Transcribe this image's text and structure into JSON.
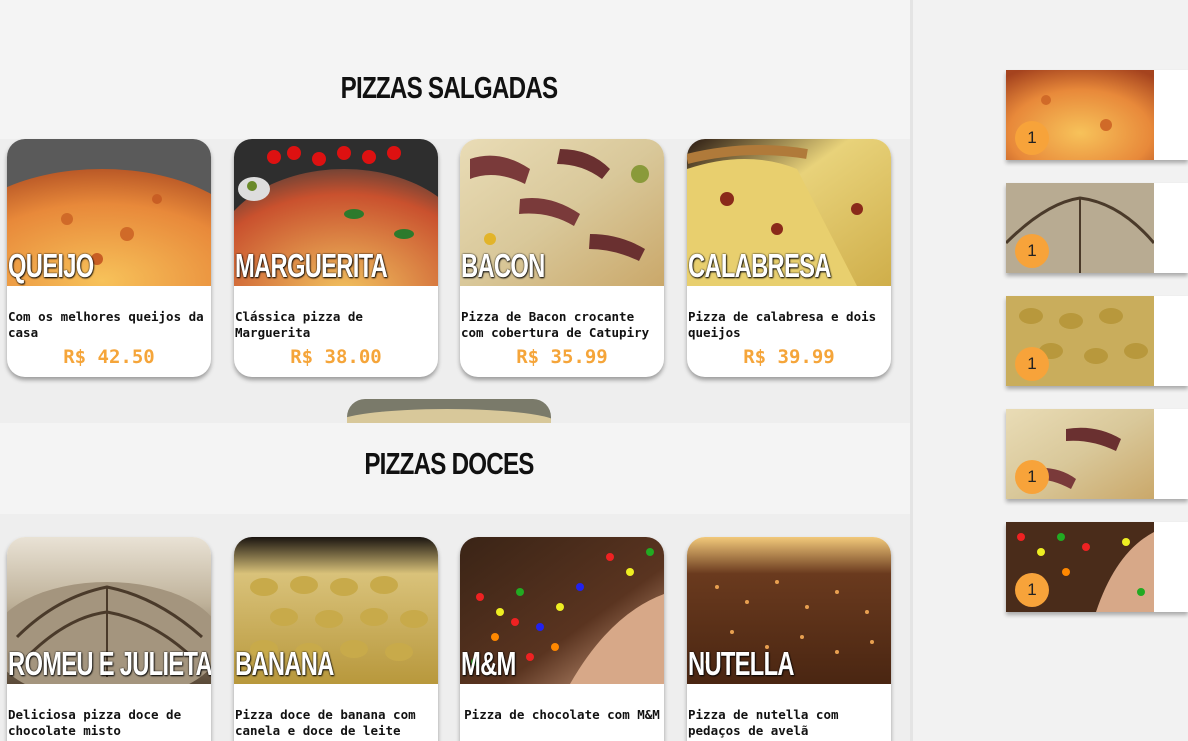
{
  "sections": [
    {
      "title": "PIZZAS SALGADAS",
      "items": [
        {
          "name": "QUEIJO",
          "desc": "Com os melhores queijos da casa",
          "price": "R$ 42.50",
          "image": "cheese-pizza"
        },
        {
          "name": "MARGUERITA",
          "desc": "Clássica pizza de Marguerita",
          "price": "R$ 38.00",
          "image": "margherita-pizza"
        },
        {
          "name": "BACON",
          "desc": "Pizza de Bacon crocante com cobertura de Catupiry",
          "price": "R$ 35.99",
          "image": "bacon-pizza"
        },
        {
          "name": "CALABRESA",
          "desc": "Pizza de calabresa e dois queijos",
          "price": "R$ 39.99",
          "image": "calabresa-pizza"
        }
      ]
    },
    {
      "title": "PIZZAS DOCES",
      "items": [
        {
          "name": "ROMEU E JULIETA",
          "desc": "Deliciosa pizza doce de chocolate misto",
          "image": "romeu-julieta-pizza"
        },
        {
          "name": "BANANA",
          "desc": "Pizza doce de banana com canela e doce de leite",
          "image": "banana-pizza"
        },
        {
          "name": "M&M",
          "desc": "Pizza de chocolate com M&M",
          "image": "mm-pizza"
        },
        {
          "name": "NUTELLA",
          "desc": "Pizza de nutella com pedaços de avelã",
          "image": "nutella-pizza"
        }
      ]
    }
  ],
  "cart": [
    {
      "image": "cheese-pizza",
      "qty": "1"
    },
    {
      "image": "romeu-julieta-pizza",
      "qty": "1"
    },
    {
      "image": "banana-pizza",
      "qty": "1"
    },
    {
      "image": "bacon-pizza",
      "qty": "1"
    },
    {
      "image": "mm-pizza",
      "qty": "1"
    }
  ],
  "colors": {
    "price": "#f5a53a",
    "badge": "#f7a33a"
  }
}
